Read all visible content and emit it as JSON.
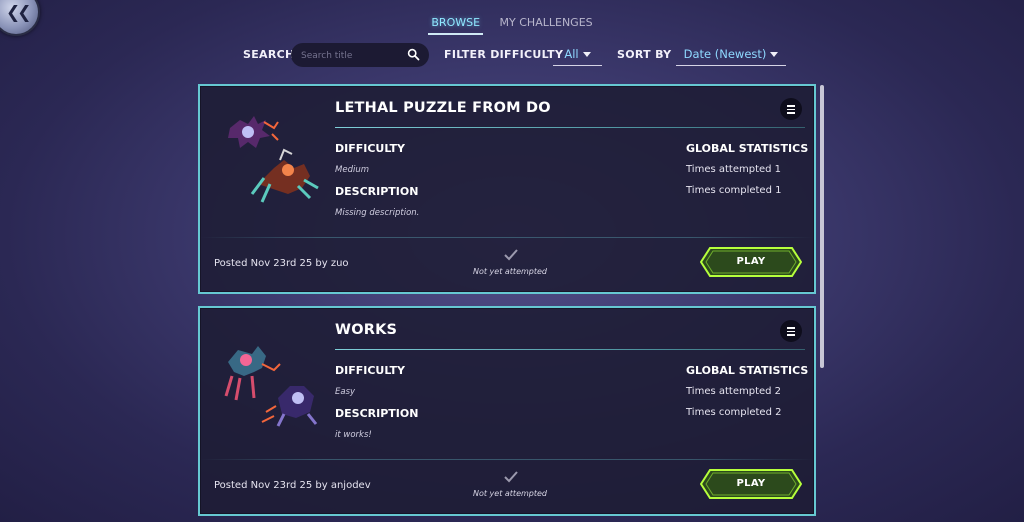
{
  "nav": {
    "back_icon": "double-chevron-left-icon"
  },
  "tabs": [
    {
      "label": "BROWSE",
      "active": true
    },
    {
      "label": "MY CHALLENGES",
      "active": false
    }
  ],
  "filters": {
    "search_label": "SEARCH",
    "search_placeholder": "Search title",
    "search_icon": "search-icon",
    "difficulty_label": "FILTER DIFFICULTY",
    "difficulty_value": "All",
    "sort_label": "SORT BY",
    "sort_value": "Date (Newest)"
  },
  "labels": {
    "difficulty": "DIFFICULTY",
    "description": "DESCRIPTION",
    "global_stats": "GLOBAL STATISTICS",
    "play": "PLAY"
  },
  "challenges": [
    {
      "title": "LETHAL PUZZLE FROM DO",
      "difficulty": "Medium",
      "description": "Missing description.",
      "times_attempted": "Times attempted 1",
      "times_completed": "Times completed 1",
      "posted": "Posted Nov 23rd 25 by zuo",
      "status": "Not yet attempted"
    },
    {
      "title": "WORKS",
      "difficulty": "Easy",
      "description": "it works!",
      "times_attempted": "Times attempted 2",
      "times_completed": "Times completed 2",
      "posted": "Posted Nov 23rd 25 by anjodev",
      "status": "Not yet attempted"
    }
  ],
  "colors": {
    "accent_cyan": "#8fe8ff",
    "card_border": "#66c8d2",
    "play_green": "#b6ff3c",
    "background": "#3e3b70"
  }
}
